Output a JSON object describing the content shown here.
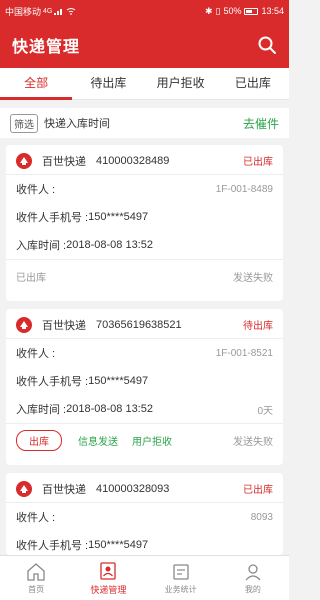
{
  "status_bar": {
    "carrier": "中国移动",
    "signal": "4G",
    "battery": "50%",
    "time": "13:54"
  },
  "header": {
    "title": "快递管理"
  },
  "tabs": [
    {
      "label": "全部",
      "active": true
    },
    {
      "label": "待出库",
      "active": false
    },
    {
      "label": "用户拒收",
      "active": false
    },
    {
      "label": "已出库",
      "active": false
    }
  ],
  "filter": {
    "chip": "筛选",
    "label": "快递入库时间",
    "urge": "去催件"
  },
  "cards": [
    {
      "company": "百世快递",
      "tracking": "410000328489",
      "status": "已出库",
      "recipient_label": "收件人 :",
      "recipient": "",
      "shelf": "1F-001-8489",
      "phone_label": "收件人手机号 :",
      "phone": "150****5497",
      "time_label": "入库时间 :",
      "time": "2018-08-08 13:52",
      "days": "",
      "footer_left": "已出库",
      "footer_right": "发送失败"
    },
    {
      "company": "百世快递",
      "tracking": "70365619638521",
      "status": "待出库",
      "recipient_label": "收件人 :",
      "recipient": "",
      "shelf": "1F-001-8521",
      "phone_label": "收件人手机号 :",
      "phone": "150****5497",
      "time_label": "入库时间 :",
      "time": "2018-08-08 13:52",
      "days": "0天",
      "actions": {
        "out": "出库",
        "resend": "信息发送",
        "reject": "用户拒收"
      },
      "footer_right": "发送失败"
    },
    {
      "company": "百世快递",
      "tracking": "410000328093",
      "status": "已出库",
      "recipient_label": "收件人 :",
      "recipient": "",
      "shelf": "8093",
      "phone_label": "收件人手机号 :",
      "phone": "150****5497"
    }
  ],
  "bottom_nav": [
    {
      "label": "首页",
      "icon": "home-icon",
      "active": false
    },
    {
      "label": "快递管理",
      "icon": "parcel-manage-icon",
      "active": true
    },
    {
      "label": "业务统计",
      "icon": "stats-icon",
      "active": false
    },
    {
      "label": "我的",
      "icon": "profile-icon",
      "active": false
    }
  ],
  "colors": {
    "brand": "#d92b2b",
    "green": "#2aa44a",
    "muted": "#999999"
  }
}
